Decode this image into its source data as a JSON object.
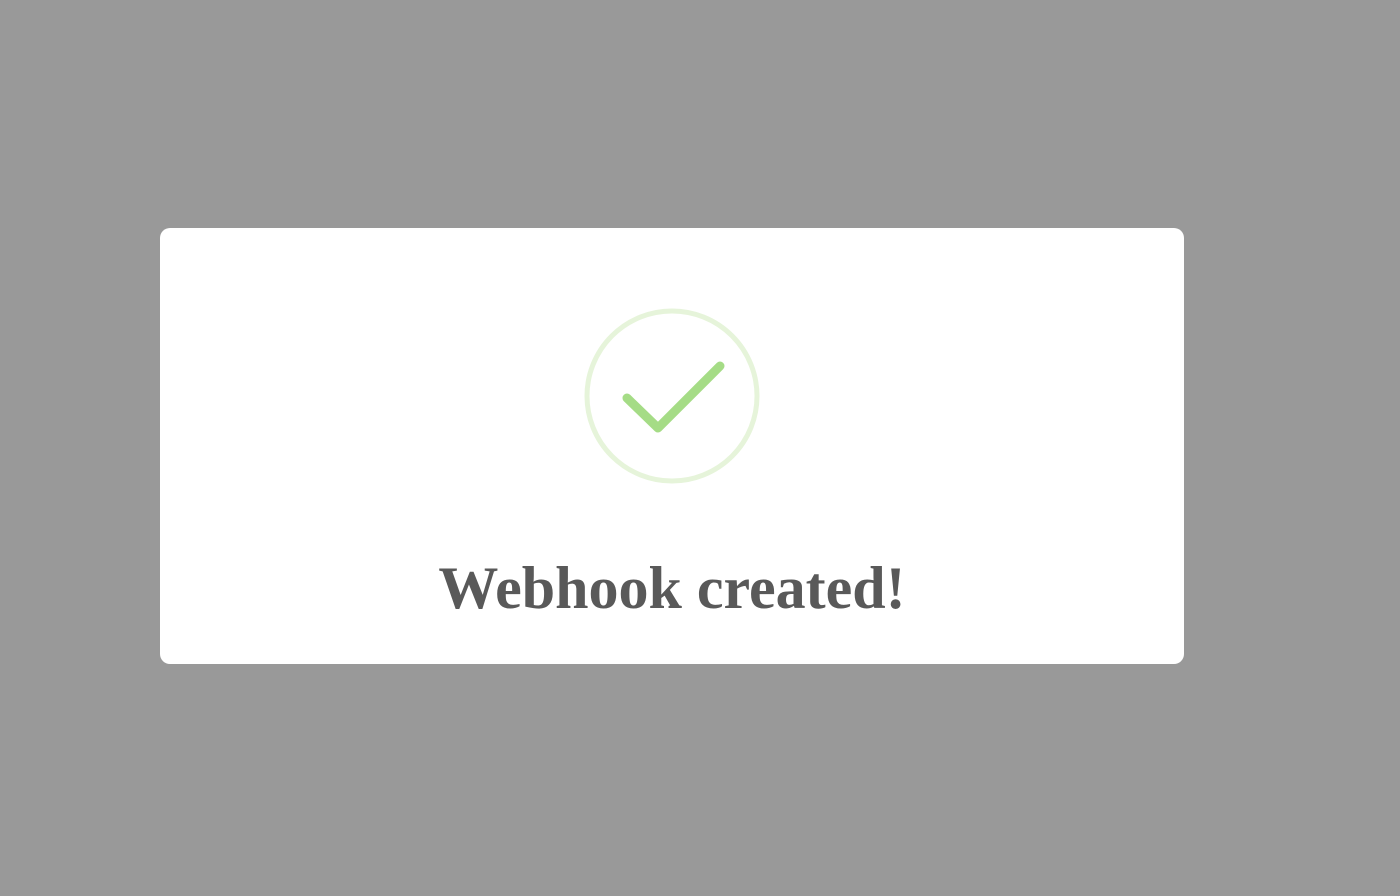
{
  "modal": {
    "title": "Webhook created!",
    "icon": "success-check-icon",
    "colors": {
      "overlay": "#999999",
      "icon_ring": "#e6f4da",
      "icon_check": "#a5dc86",
      "title": "#595959"
    }
  }
}
